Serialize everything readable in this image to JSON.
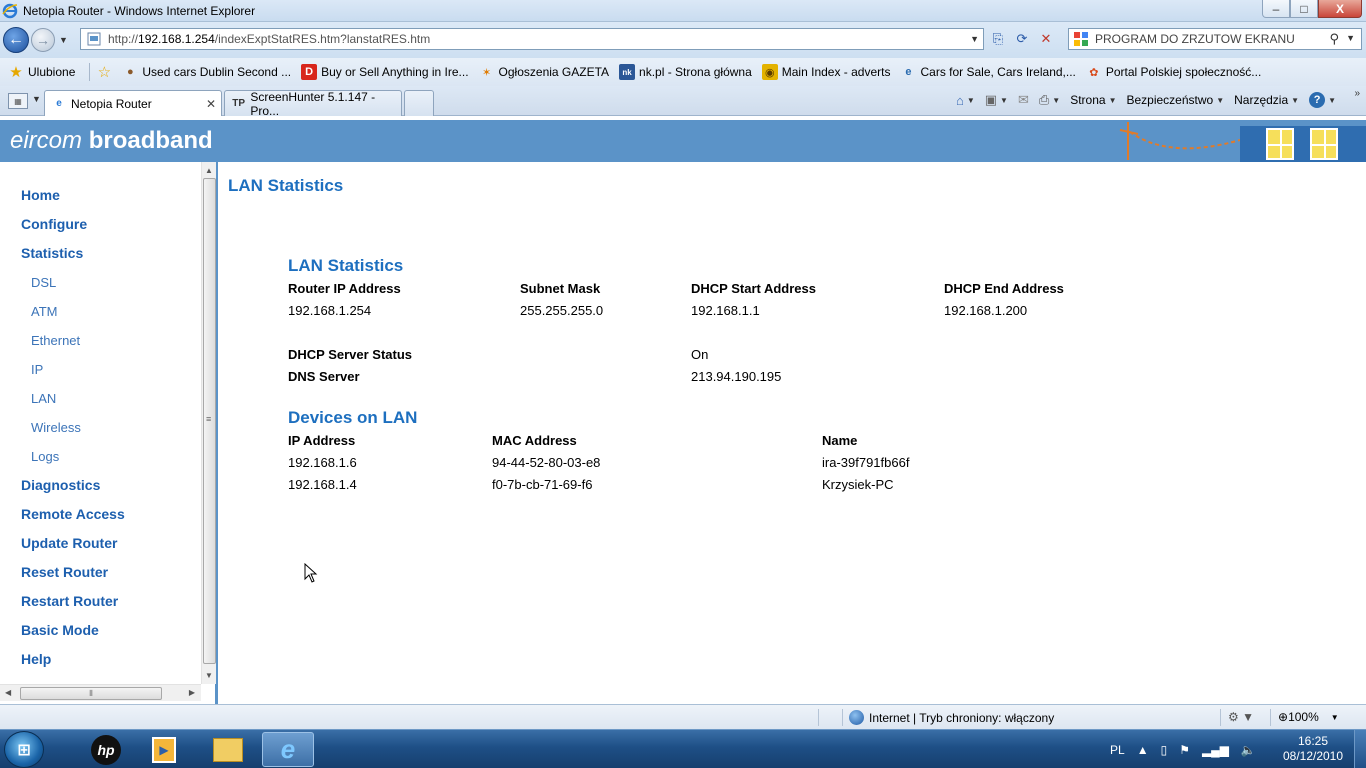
{
  "window": {
    "title": "Netopia Router - Windows Internet Explorer",
    "minimize": "–",
    "maximize": "□",
    "close": "X"
  },
  "address_bar": {
    "url_prefix": "http://",
    "url_host": "192.168.1.254",
    "url_path": "/indexExptStatRES.htm?lanstatRES.htm"
  },
  "search": {
    "placeholder": "PROGRAM DO ZRZUTOW EKRANU"
  },
  "favorites": {
    "main_label": "Ulubione",
    "items": [
      {
        "label": "Used cars Dublin Second ...",
        "icon": "car-icon",
        "color": "#8b5a2b"
      },
      {
        "label": "Buy or Sell Anything in Ire...",
        "icon": "d-icon",
        "color": "#d8261c"
      },
      {
        "label": "Ogłoszenia GAZETA",
        "icon": "runner-icon",
        "color": "#e07b00"
      },
      {
        "label": "nk.pl - Strona główna",
        "icon": "nk-icon",
        "color": "#2b5797"
      },
      {
        "label": "Main Index - adverts",
        "icon": "adverts-icon",
        "color": "#e3b200"
      },
      {
        "label": "Cars for Sale, Cars Ireland,...",
        "icon": "ie-icon",
        "color": "#2b6cb0"
      },
      {
        "label": "Portal Polskiej społeczność...",
        "icon": "portal-icon",
        "color": "#d84a1b"
      }
    ]
  },
  "tabs": [
    {
      "label": "Netopia Router",
      "icon": "ie-icon",
      "active": true
    },
    {
      "label": "ScreenHunter 5.1.147 - Pro...",
      "icon": "tp-icon",
      "active": false
    }
  ],
  "commands": {
    "page": "Strona",
    "safety": "Bezpieczeństwo",
    "tools": "Narzędzia"
  },
  "banner": {
    "brand_italic": "eircom",
    "brand_bold": "broadband"
  },
  "nav": {
    "home": "Home",
    "configure": "Configure",
    "statistics": "Statistics",
    "dsl": "DSL",
    "atm": "ATM",
    "ethernet": "Ethernet",
    "ip": "IP",
    "lan": "LAN",
    "wireless": "Wireless",
    "logs": "Logs",
    "diagnostics": "Diagnostics",
    "remote_access": "Remote Access",
    "update_router": "Update Router",
    "reset_router": "Reset Router",
    "restart_router": "Restart Router",
    "basic_mode": "Basic Mode",
    "help": "Help"
  },
  "main": {
    "page_title": "LAN Statistics",
    "lan_section": {
      "title": "LAN Statistics",
      "headers": [
        "Router IP Address",
        "Subnet Mask",
        "DHCP Start Address",
        "DHCP End Address"
      ],
      "values": [
        "192.168.1.254",
        "255.255.255.0",
        "192.168.1.1",
        "192.168.1.200"
      ],
      "dhcp_server_status_label": "DHCP Server Status",
      "dhcp_server_status_value": "On",
      "dns_server_label": "DNS Server",
      "dns_server_value": "213.94.190.195"
    },
    "devices_section": {
      "title": "Devices on LAN",
      "headers": [
        "IP Address",
        "MAC Address",
        "Name"
      ],
      "rows": [
        [
          "192.168.1.6",
          "94-44-52-80-03-e8",
          "ira-39f791fb66f"
        ],
        [
          "192.168.1.4",
          "f0-7b-cb-71-69-f6",
          "Krzysiek-PC"
        ]
      ]
    }
  },
  "status_bar": {
    "zone": "Internet | Tryb chroniony: włączony",
    "zoom": "100%"
  },
  "taskbar": {
    "language": "PL",
    "time": "16:25",
    "date": "08/12/2010"
  }
}
